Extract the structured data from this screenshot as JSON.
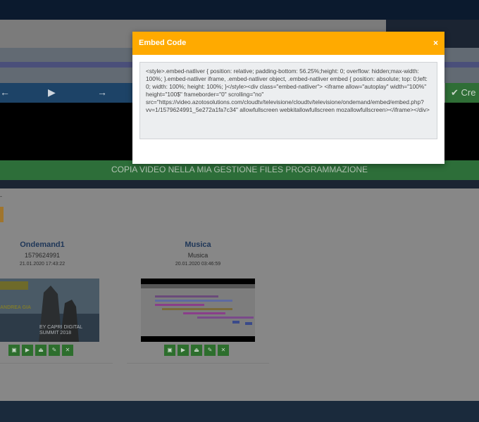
{
  "background": {
    "create_button_label": "Cre",
    "copy_bar_label": "COPIA VIDEO NELLA MIA GESTIONE FILES PROGRAMMAZIONE",
    "controls": [
      "←",
      "▶",
      "→"
    ],
    "small_marker": "-",
    "cards": [
      {
        "title": "Ondemand1",
        "subtitle": "1579624991",
        "date": "21.01.2020 17:43:22",
        "thumb_text": "EY CAPRI DIGITAL SUMMIT 2018",
        "thumb_text2": "ANDREA GIA"
      },
      {
        "title": "Musica",
        "subtitle": "Musica",
        "date": "20.01.2020 03:46:59"
      }
    ]
  },
  "modal": {
    "title": "Embed Code",
    "close": "×",
    "code": "<style>.embed-natliver { position: relative; padding-bottom: 56.25%;height: 0; overflow: hidden;max-width: 100%; }.embed-natliver iframe, .embed-natliver object, .embed-natliver embed { position: absolute; top: 0;left: 0; width: 100%; height: 100%; }</style><div class=\"embed-natliver\"> <iframe allow=\"autoplay\" width=\"100%\" height=\"100$\" frameborder=\"0\" scrolling=\"no\" src=\"https://video.azotosolutions.com/cloudtv/televisione/cloudtv/televisione/ondemand/embed/embed.php?vv=1/1579624991_5e272a1fa7c34\" allowfullscreen webkitallowfullscreen mozallowfullscreen></iframe></div>"
  },
  "colors": {
    "modal_header": "#ffaa00",
    "green_button": "#2d6e2d"
  }
}
